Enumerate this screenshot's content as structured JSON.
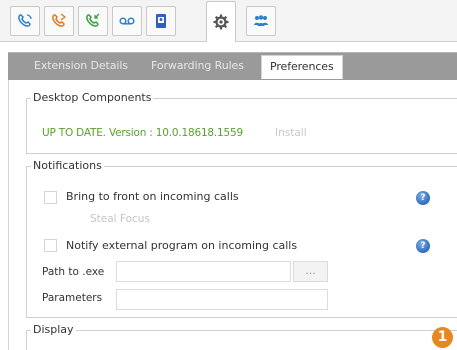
{
  "icon_tabs": [
    {
      "name": "phone-icon",
      "color": "#2f7fcf"
    },
    {
      "name": "phone-forward-icon",
      "color": "#e07a22"
    },
    {
      "name": "phone-incoming-icon",
      "color": "#3aa03a"
    },
    {
      "name": "voicemail-icon",
      "color": "#2f7fcf"
    },
    {
      "name": "contacts-book-icon",
      "color": "#2f5fbf"
    },
    {
      "name": "gear-icon",
      "color": "#555555"
    },
    {
      "name": "group-icon",
      "color": "#2f7fcf"
    }
  ],
  "subtabs": {
    "extension_details": "Extension Details",
    "forwarding_rules": "Forwarding Rules",
    "preferences": "Preferences"
  },
  "desktop_components": {
    "legend": "Desktop Components",
    "version": "UP TO DATE. Version :  10.0.18618.1559",
    "install": "Install"
  },
  "notifications": {
    "legend": "Notifications",
    "bring_to_front": "Bring to front on incoming calls",
    "steal_focus": "Steal Focus",
    "notify_external": "Notify external program on incoming calls",
    "path_label": "Path to .exe",
    "path_value": "",
    "browse_label": "...",
    "parameters_label": "Parameters",
    "parameters_value": ""
  },
  "display": {
    "legend": "Display"
  },
  "badge": {
    "number": "1",
    "color": "#e6871f"
  },
  "colors": {
    "version_text": "#5aa02c",
    "help_icon": "#2a6cc2",
    "subtab_bar": "#9a9a9a"
  }
}
